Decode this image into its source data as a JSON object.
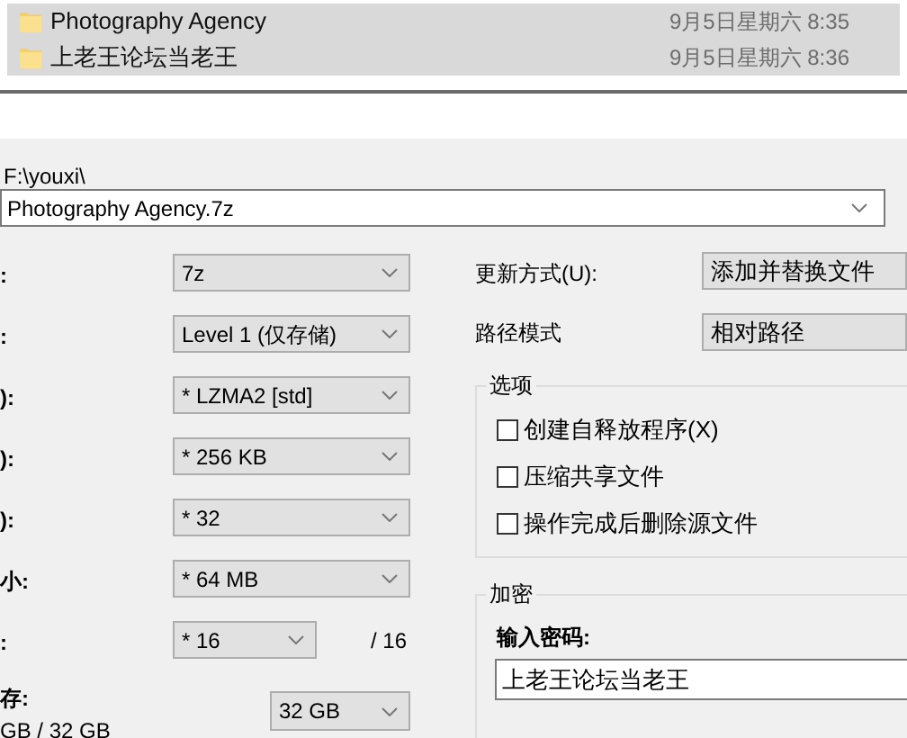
{
  "file_list": [
    {
      "name": "Photography Agency",
      "date": "9月5日星期六 8:35",
      "selected": true
    },
    {
      "name": "上老王论坛当老王",
      "date": "9月5日星期六 8:36",
      "selected": true
    }
  ],
  "dialog": {
    "folder": "F:\\youxi\\",
    "archive": "Photography Agency.7z",
    "left_rows": [
      {
        "kind": "combo",
        "label": ":",
        "value": "7z"
      },
      {
        "kind": "combo",
        "label": ":",
        "value": "Level 1 (仅存储)"
      },
      {
        "kind": "combo",
        "label": "):",
        "value": "* LZMA2 [std]"
      },
      {
        "kind": "combo",
        "label": "):",
        "value": "* 256 KB"
      },
      {
        "kind": "combo",
        "label": "):",
        "value": "* 32"
      },
      {
        "kind": "combo",
        "label": "小:",
        "value": "* 64 MB"
      },
      {
        "kind": "threads",
        "label": ":",
        "value": "* 16",
        "suffix": "/ 16"
      },
      {
        "kind": "memory",
        "label": "存:",
        "sublabel": "GB / 32 GB",
        "value": "32 GB"
      }
    ],
    "update_mode": {
      "label": "更新方式(U):",
      "value": "添加并替换文件"
    },
    "path_mode": {
      "label": "路径模式",
      "value": "相对路径"
    },
    "options": {
      "title": "选项",
      "items": [
        {
          "label": "创建自释放程序(X)",
          "checked": false
        },
        {
          "label": "压缩共享文件",
          "checked": false
        },
        {
          "label": "操作完成后删除源文件",
          "checked": false
        }
      ]
    },
    "encryption": {
      "title": "加密",
      "password_label": "输入密码:",
      "password": "上老王论坛当老王"
    }
  }
}
